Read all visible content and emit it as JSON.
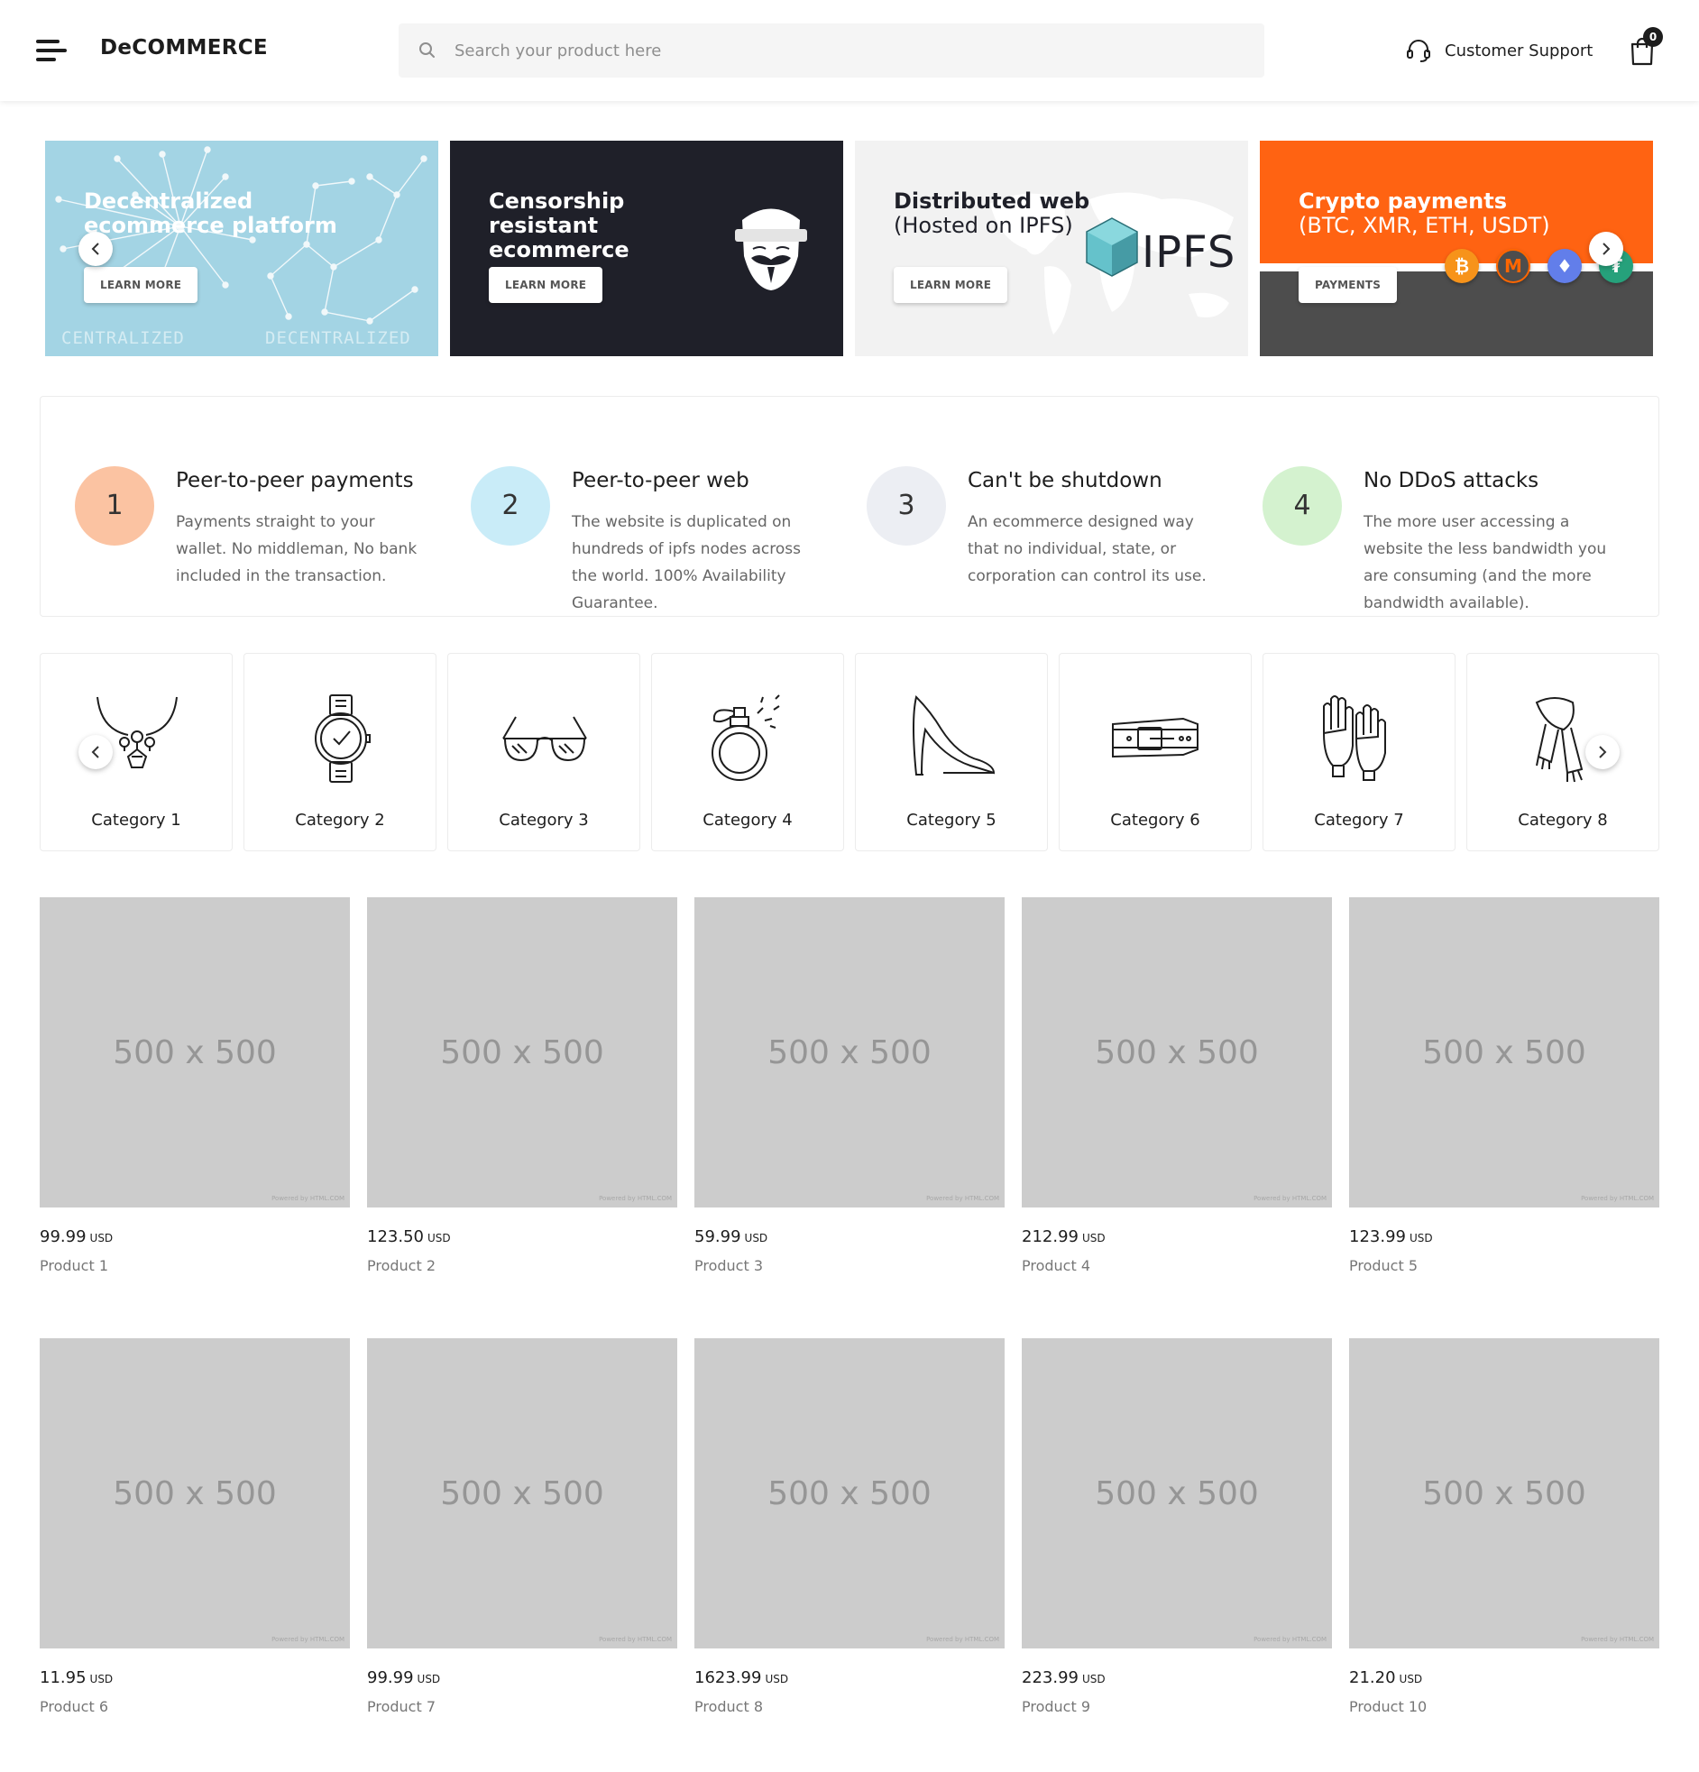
{
  "header": {
    "logo": "DeCOMMERCE",
    "search_placeholder": "Search your product here",
    "support_label": "Customer Support",
    "cart_count": "0"
  },
  "banners": [
    {
      "title": "Decentralized ecommerce platform",
      "subtitle": "",
      "button": "LEARN MORE",
      "watermark_left": "CENTRALIZED",
      "watermark_right": "DECENTRALIZED",
      "bg": "#a3d4e4"
    },
    {
      "title": "Censorship resistant ecommerce",
      "subtitle": "",
      "button": "LEARN MORE",
      "bg": "#1f2029"
    },
    {
      "title": "Distributed web",
      "subtitle": "(Hosted on IPFS)",
      "button": "LEARN MORE",
      "logo_text": "IPFS",
      "bg": "#f2f2f2"
    },
    {
      "title": "Crypto payments",
      "subtitle": "(BTC, XMR, ETH, USDT)",
      "button": "PAYMENTS",
      "bg": "#ff6312"
    }
  ],
  "features": [
    {
      "num": "1",
      "title": "Peer-to-peer payments",
      "desc": "Payments straight to your wallet. No middleman, No bank included in the transaction.",
      "color": "#fbc3a2"
    },
    {
      "num": "2",
      "title": "Peer-to-peer web",
      "desc": "The website is duplicated on hundreds of ipfs nodes across the world. 100% Availability Guarantee.",
      "color": "#c9ecf8"
    },
    {
      "num": "3",
      "title": "Can't be shutdown",
      "desc": "An ecommerce designed way that no individual, state, or corporation can control its use.",
      "color": "#eceef3"
    },
    {
      "num": "4",
      "title": "No DDoS attacks",
      "desc": "The more user accessing a website the less bandwidth you are consuming (and the more bandwidth available).",
      "color": "#d4f2cf"
    }
  ],
  "categories": [
    {
      "label": "Category 1",
      "icon": "necklace-icon"
    },
    {
      "label": "Category 2",
      "icon": "watch-icon"
    },
    {
      "label": "Category 3",
      "icon": "sunglasses-icon"
    },
    {
      "label": "Category 4",
      "icon": "perfume-icon"
    },
    {
      "label": "Category 5",
      "icon": "high-heel-icon"
    },
    {
      "label": "Category 6",
      "icon": "belt-icon"
    },
    {
      "label": "Category 7",
      "icon": "gloves-icon"
    },
    {
      "label": "Category 8",
      "icon": "scarf-icon"
    }
  ],
  "products": [
    {
      "price": "99.99",
      "currency": "USD",
      "name": "Product 1",
      "placeholder": "500 x 500",
      "powered": "Powered by HTML.COM"
    },
    {
      "price": "123.50",
      "currency": "USD",
      "name": "Product 2",
      "placeholder": "500 x 500",
      "powered": "Powered by HTML.COM"
    },
    {
      "price": "59.99",
      "currency": "USD",
      "name": "Product 3",
      "placeholder": "500 x 500",
      "powered": "Powered by HTML.COM"
    },
    {
      "price": "212.99",
      "currency": "USD",
      "name": "Product 4",
      "placeholder": "500 x 500",
      "powered": "Powered by HTML.COM"
    },
    {
      "price": "123.99",
      "currency": "USD",
      "name": "Product 5",
      "placeholder": "500 x 500",
      "powered": "Powered by HTML.COM"
    },
    {
      "price": "11.95",
      "currency": "USD",
      "name": "Product 6",
      "placeholder": "500 x 500",
      "powered": "Powered by HTML.COM"
    },
    {
      "price": "99.99",
      "currency": "USD",
      "name": "Product 7",
      "placeholder": "500 x 500",
      "powered": "Powered by HTML.COM"
    },
    {
      "price": "1623.99",
      "currency": "USD",
      "name": "Product 8",
      "placeholder": "500 x 500",
      "powered": "Powered by HTML.COM"
    },
    {
      "price": "223.99",
      "currency": "USD",
      "name": "Product 9",
      "placeholder": "500 x 500",
      "powered": "Powered by HTML.COM"
    },
    {
      "price": "21.20",
      "currency": "USD",
      "name": "Product 10",
      "placeholder": "500 x 500",
      "powered": "Powered by HTML.COM"
    }
  ],
  "colors": {
    "accent_orange": "#ff6312",
    "dark": "#1f2029",
    "placeholder_gray": "#cccccc"
  }
}
